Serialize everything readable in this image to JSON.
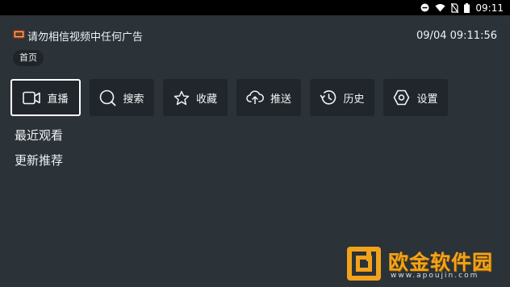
{
  "status_bar": {
    "time": "09:11",
    "icons": [
      "minus-circle-icon",
      "wifi-icon",
      "no-sim-icon",
      "battery-icon"
    ]
  },
  "header": {
    "notice_icon": "tv-icon",
    "notice": "请勿相信视频中任何广告",
    "datetime": "09/04 09:11:56"
  },
  "breadcrumb": "首页",
  "nav": [
    {
      "label": "直播",
      "icon": "camera-icon",
      "active": true
    },
    {
      "label": "搜索",
      "icon": "search-icon",
      "active": false
    },
    {
      "label": "收藏",
      "icon": "star-icon",
      "active": false
    },
    {
      "label": "推送",
      "icon": "cloud-upload-icon",
      "active": false
    },
    {
      "label": "历史",
      "icon": "history-icon",
      "active": false
    },
    {
      "label": "设置",
      "icon": "settings-icon",
      "active": false
    }
  ],
  "sections": {
    "recent": "最近观看",
    "updates": "更新推荐"
  },
  "watermark": {
    "brand": "欧金软件园",
    "url": "www.apoujin.com"
  },
  "colors": {
    "background": "#2b3238",
    "tile": "#20262b",
    "accent": "#f2a31a"
  }
}
